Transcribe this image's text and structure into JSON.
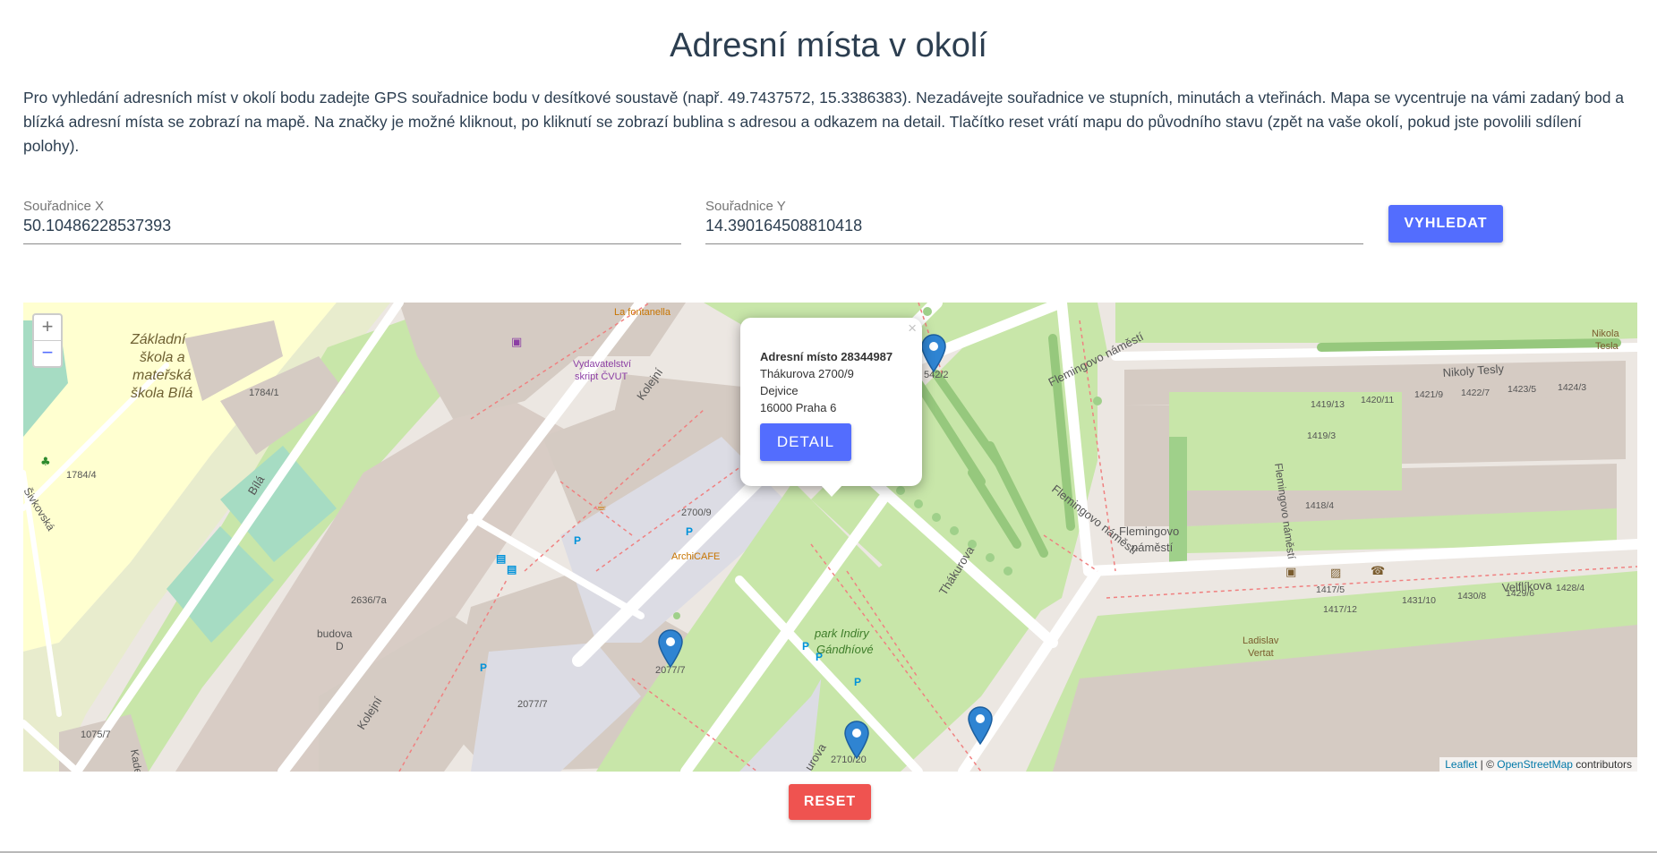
{
  "page": {
    "title": "Adresní místa v okolí",
    "intro": "Pro vyhledání adresních míst v okolí bodu zadejte GPS souřadnice bodu v desítkové soustavě (např. 49.7437572, 15.3386383). Nezadávejte souřadnice ve stupních, minutách a vteřinách. Mapa se vycentruje na vámi zadaný bod a blízká adresní místa se zobrazí na mapě. Na značky je možné kliknout, po kliknutí se zobrazí bublina s adresou a odkazem na detail. Tlačítko reset vrátí mapu do původního stavu (zpět na vaše okolí, pokud jste povolili sdílení polohy)."
  },
  "form": {
    "x_label": "Souřadnice X",
    "x_value": "50.10486228537393",
    "y_label": "Souřadnice Y",
    "y_value": "14.390164508810418",
    "search_label": "VYHLEDAT",
    "reset_label": "RESET"
  },
  "map": {
    "zoom_in": "+",
    "zoom_out": "−",
    "popup": {
      "close": "×",
      "title": "Adresní místo 28344987",
      "street": "Thákurova 2700/9",
      "district": "Dejvice",
      "city": "16000 Praha 6",
      "detail_label": "DETAIL"
    },
    "attribution": {
      "leaflet": "Leaflet",
      "sep": " | © ",
      "osm": "OpenStreetMap",
      "suffix": " contributors"
    },
    "labels": {
      "school": [
        "Základní",
        "škola a",
        "mateřská",
        "škola Bílá"
      ],
      "la_fontanella": "La fontanella",
      "vydavatelstvi": [
        "Vydavatelství",
        "skript ČVUT"
      ],
      "kolejni": "Kolejní",
      "bila": "Bílá",
      "n1784_1": "1784/1",
      "n1784_4": "1784/4",
      "n2700_9": "2700/9",
      "archicafe": "ArchiCAFE",
      "n2636_7a": "2636/7a",
      "budova": [
        "budova",
        "D"
      ],
      "n2077_7a": "2077/7",
      "n2077_7b": "2077/7",
      "n1075_7": "1075/7",
      "kolejni2": "Kolejní",
      "kade": "Kade",
      "sivkovska": "Šivkovská",
      "park": [
        "park Indiry",
        "Gándhíové"
      ],
      "thakurova": "Thákurova",
      "thakurova2": "urova",
      "n2710_20": "2710/20",
      "n542_2": "542/2",
      "flemingovo1": "Flemingovo náměstí",
      "flemingovo2": "Flemingovo náměstí",
      "flemingovo_sq": [
        "Flemingovo",
        "náměstí"
      ],
      "flemingovo_v": "Flemingovo náměstí",
      "nikoly_tesly": "Nikoly Tesly",
      "tesla": [
        "Nikola",
        "Tesla"
      ],
      "velflikova": "Velflíkova",
      "ladislav": [
        "Ladislav",
        "Vertat"
      ],
      "n1419_13": "1419/13",
      "n1420_11": "1420/11",
      "n1421_9": "1421/9",
      "n1422_7": "1422/7",
      "n1423_5": "1423/5",
      "n1424_3": "1424/3",
      "n1419_3": "1419/3",
      "n1418_4": "1418/4",
      "n1417_5": "1417/5",
      "n1417_12": "1417/12",
      "n1431_10": "1431/10",
      "n1430_8": "1430/8",
      "n1429_6": "1429/6",
      "n1428_4": "1428/4"
    }
  }
}
